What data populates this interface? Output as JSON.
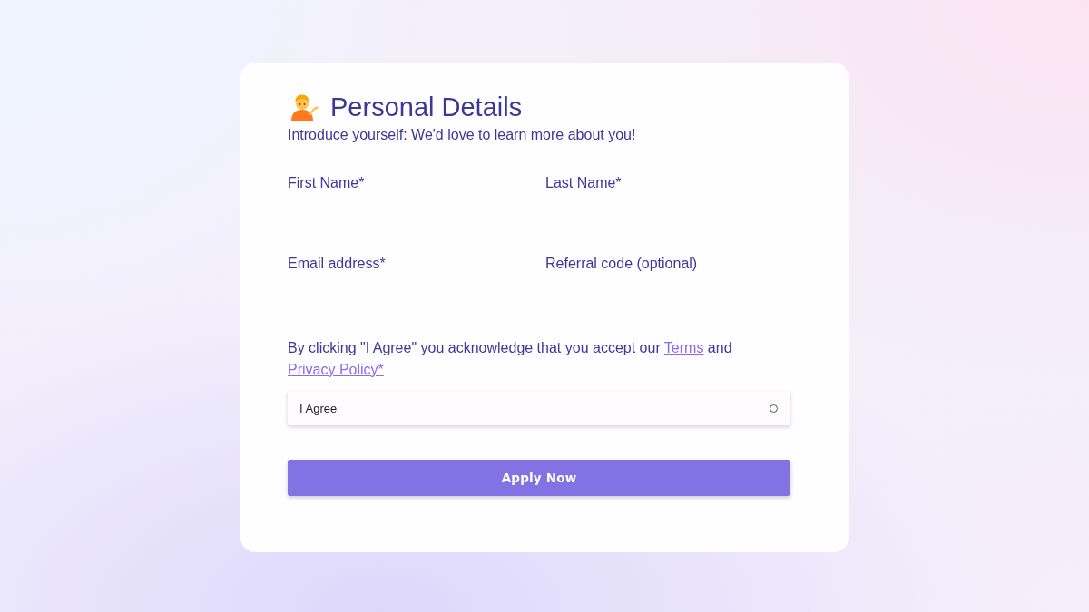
{
  "form": {
    "title": "Personal Details",
    "subtitle": "Introduce yourself: We'd love to learn more about you!",
    "fields": [
      {
        "label": "First Name*"
      },
      {
        "label": "Last Name*"
      },
      {
        "label": "Email address*"
      },
      {
        "label": "Referral code (optional)"
      }
    ],
    "consent": {
      "parts": [
        {
          "kind": "text",
          "text": "By clicking \"I Agree\" you acknowledge that you accept our "
        },
        {
          "kind": "link",
          "text": "Terms"
        },
        {
          "kind": "text",
          "text": " and "
        },
        {
          "kind": "link",
          "text": "Privacy Policy*"
        }
      ]
    },
    "agree": {
      "label": "I Agree",
      "checked": false
    },
    "submit": {
      "label": "Apply Now"
    }
  }
}
